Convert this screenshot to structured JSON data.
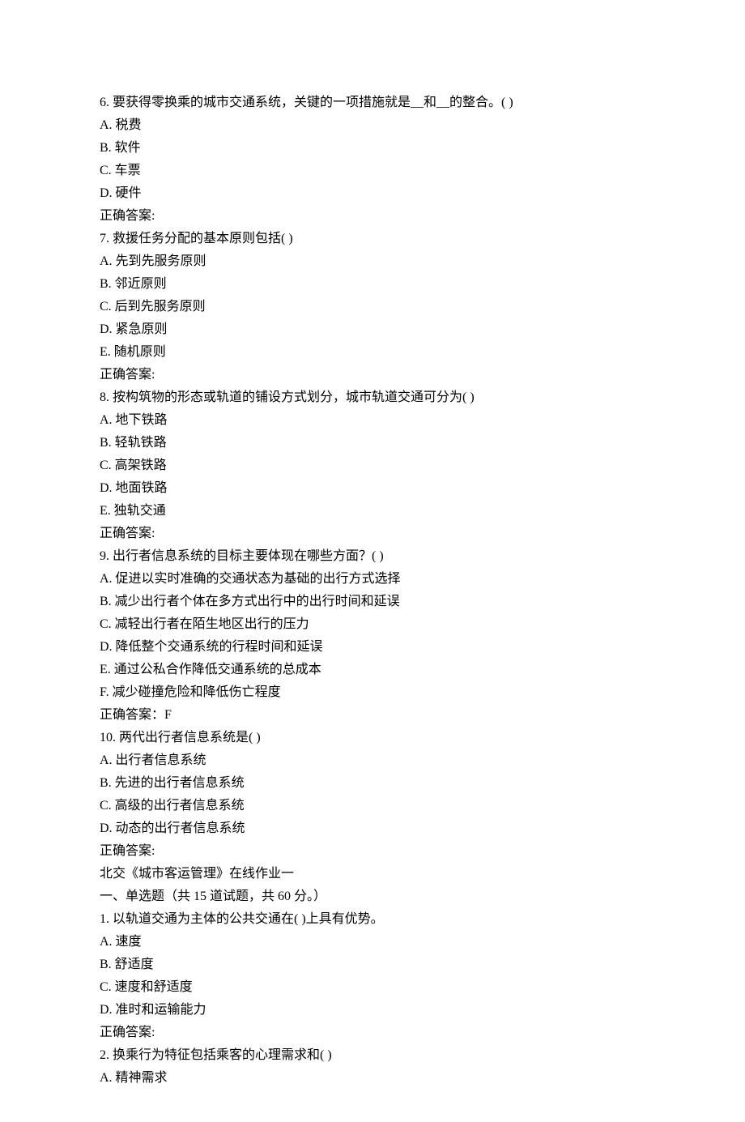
{
  "questions": [
    {
      "number": "6. ",
      "stem": "要获得零换乘的城市交通系统，关键的一项措施就是__和__的整合。( )",
      "options": [
        "A. 税费",
        "B. 软件",
        "C. 车票",
        "D. 硬件"
      ],
      "answer_label": "正确答案:",
      "answer_value": ""
    },
    {
      "number": "7. ",
      "stem": "救援任务分配的基本原则包括( )",
      "options": [
        "A. 先到先服务原则",
        "B. 邻近原则",
        "C. 后到先服务原则",
        "D. 紧急原则",
        "E. 随机原则"
      ],
      "answer_label": "正确答案:",
      "answer_value": ""
    },
    {
      "number": "8. ",
      "stem": "按构筑物的形态或轨道的铺设方式划分，城市轨道交通可分为( )",
      "options": [
        "A. 地下铁路",
        "B. 轻轨铁路",
        "C. 高架铁路",
        "D. 地面铁路",
        "E. 独轨交通"
      ],
      "answer_label": "正确答案:",
      "answer_value": ""
    },
    {
      "number": "9. ",
      "stem": "出行者信息系统的目标主要体现在哪些方面？( )",
      "options": [
        "A. 促进以实时准确的交通状态为基础的出行方式选择",
        "B. 减少出行者个体在多方式出行中的出行时间和延误",
        "C. 减轻出行者在陌生地区出行的压力",
        "D. 降低整个交通系统的行程时间和延误",
        "E. 通过公私合作降低交通系统的总成本",
        "F. 减少碰撞危险和降低伤亡程度"
      ],
      "answer_label": "正确答案：",
      "answer_value": "F"
    },
    {
      "number": "10. ",
      "stem": "两代出行者信息系统是( )",
      "options": [
        "A. 出行者信息系统",
        "B. 先进的出行者信息系统",
        "C. 高级的出行者信息系统",
        "D. 动态的出行者信息系统"
      ],
      "answer_label": "正确答案:",
      "answer_value": ""
    }
  ],
  "section2": {
    "title": "北交《城市客运管理》在线作业一",
    "subtitle": "一、单选题（共 15 道试题，共 60 分。）",
    "questions": [
      {
        "number": "1. ",
        "stem": "以轨道交通为主体的公共交通在( )上具有优势。",
        "options": [
          "A. 速度",
          "B. 舒适度",
          "C. 速度和舒适度",
          "D. 准时和运输能力"
        ],
        "answer_label": "正确答案:",
        "answer_value": ""
      },
      {
        "number": "2. ",
        "stem": "换乘行为特征包括乘客的心理需求和( )",
        "options": [
          "A. 精神需求"
        ],
        "answer_label": "",
        "answer_value": ""
      }
    ]
  }
}
